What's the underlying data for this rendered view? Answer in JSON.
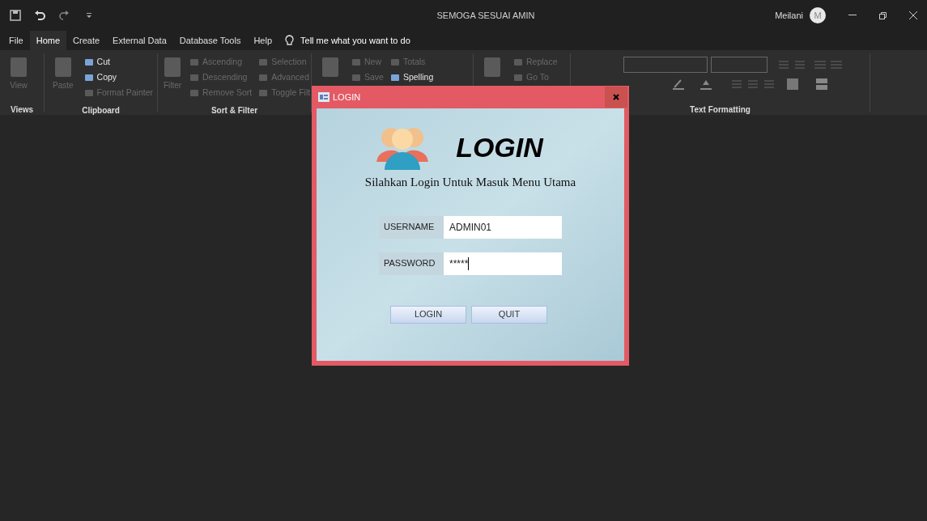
{
  "window": {
    "title": "SEMOGA SESUAI AMIN",
    "user_name": "Meilani",
    "avatar_initial": "M"
  },
  "tabs": [
    {
      "label": "File",
      "selected": false
    },
    {
      "label": "Home",
      "selected": true
    },
    {
      "label": "Create",
      "selected": false
    },
    {
      "label": "External Data",
      "selected": false
    },
    {
      "label": "Database Tools",
      "selected": false
    },
    {
      "label": "Help",
      "selected": false
    }
  ],
  "tell_me": "Tell me what you want to do",
  "ribbon": [
    {
      "label": "Views",
      "items": [
        {
          "kind": "large",
          "label": "View",
          "disabled": true
        }
      ]
    },
    {
      "label": "Clipboard",
      "items": [
        {
          "kind": "large",
          "label": "Paste",
          "disabled": true
        },
        {
          "kind": "small",
          "label": "Cut",
          "disabled": false
        },
        {
          "kind": "small",
          "label": "Copy",
          "disabled": false
        },
        {
          "kind": "small",
          "label": "Format Painter",
          "disabled": true
        }
      ]
    },
    {
      "label": "Sort & Filter",
      "items": [
        {
          "kind": "large",
          "label": "Filter",
          "disabled": true
        },
        {
          "kind": "small",
          "label": "Ascending",
          "disabled": true
        },
        {
          "kind": "small",
          "label": "Descending",
          "disabled": true
        },
        {
          "kind": "small",
          "label": "Remove Sort",
          "disabled": true
        },
        {
          "kind": "small",
          "label": "Selection",
          "disabled": true
        },
        {
          "kind": "small",
          "label": "Advanced",
          "disabled": true
        },
        {
          "kind": "small",
          "label": "Toggle Filt",
          "disabled": true
        }
      ]
    },
    {
      "items": [
        {
          "kind": "large",
          "disabled": true
        },
        {
          "kind": "small",
          "label": "New",
          "disabled": true
        },
        {
          "kind": "small",
          "label": "Save",
          "disabled": true
        },
        {
          "kind": "spacer"
        },
        {
          "kind": "small",
          "label": "Totals",
          "disabled": true
        },
        {
          "kind": "small",
          "label": "Spelling",
          "disabled": false
        },
        {
          "kind": "spacer"
        }
      ]
    },
    {
      "items": [
        {
          "kind": "large",
          "disabled": true
        },
        {
          "kind": "small",
          "label": "Replace",
          "disabled": true
        },
        {
          "kind": "small",
          "label": "Go To",
          "disabled": true
        },
        {
          "kind": "spacer"
        }
      ]
    },
    {
      "label": "Text Formatting",
      "items": [
        {
          "kind": "formatting"
        }
      ]
    }
  ],
  "dialog": {
    "title": "LOGIN",
    "heading": "LOGIN",
    "subtitle": "Silahkan Login Untuk Masuk Menu Utama",
    "fields": [
      {
        "label": "USERNAME",
        "value": "ADMIN01"
      },
      {
        "label": "PASSWORD",
        "value": "*****",
        "focused": true
      }
    ],
    "buttons": [
      "LOGIN",
      "QUIT"
    ]
  }
}
